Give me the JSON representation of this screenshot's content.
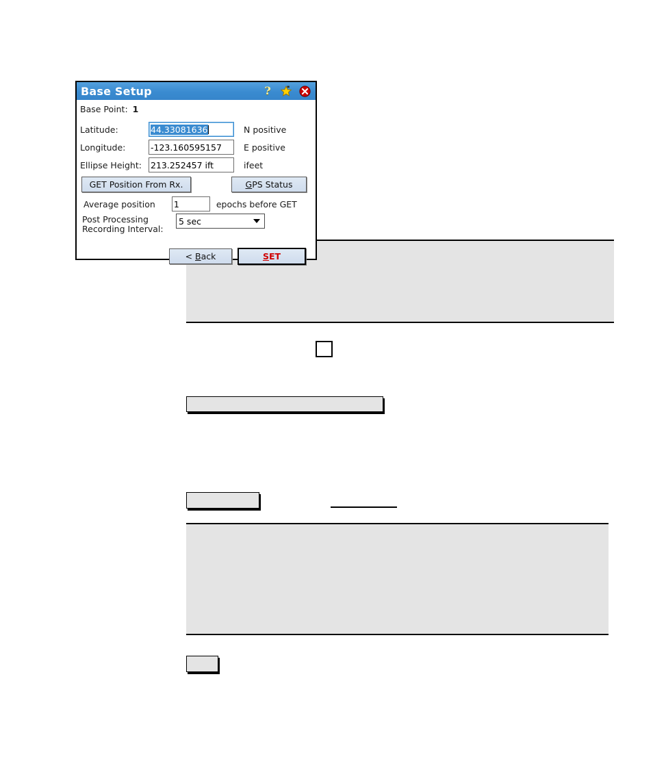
{
  "dialog": {
    "title": "Base Setup",
    "titlebar_icons": [
      {
        "name": "help-icon",
        "glyph": "?"
      },
      {
        "name": "favorites-star-icon",
        "glyph": "★"
      },
      {
        "name": "close-icon",
        "glyph": "✕"
      }
    ],
    "base_point": {
      "label": "Base Point:",
      "value": "1"
    },
    "fields": [
      {
        "label": "Latitude:",
        "value": "44.33081636",
        "suffix": "N positive",
        "focused": true
      },
      {
        "label": "Longitude:",
        "value": "-123.160595157",
        "suffix": "E positive",
        "focused": false
      },
      {
        "label": "Ellipse Height:",
        "value": "213.252457 ift",
        "suffix": "ifeet",
        "focused": false
      }
    ],
    "get_position_button": "GET Position From Rx.",
    "gps_status_button": {
      "accel": "G",
      "rest": "PS Status"
    },
    "average": {
      "prefix": "Average position",
      "value": "1",
      "suffix": "epochs before GET"
    },
    "post_processing": {
      "label_line1": "Post Processing",
      "label_line2": "Recording Interval:",
      "selected": "5 sec"
    },
    "back_button": {
      "prefix": "< ",
      "accel": "B",
      "rest": "ack"
    },
    "set_button": {
      "accel": "S",
      "rest": "ET"
    }
  },
  "colors": {
    "titlebar_blue": "#3a8bd0",
    "selection_blue": "#3a8bd0",
    "set_red": "#d00000",
    "block_gray": "#e4e4e4",
    "star_yellow": "#ffd100",
    "close_red": "#cc0000"
  }
}
